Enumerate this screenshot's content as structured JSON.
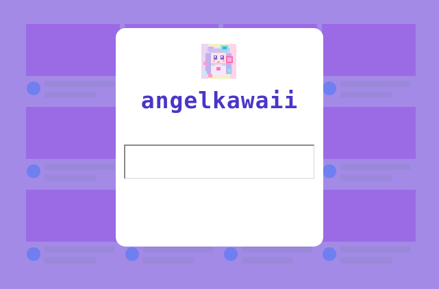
{
  "profile": {
    "username": "angelkawaii",
    "avatar_icon": "anime-girl-pixel-avatar"
  },
  "message_input": {
    "value": "",
    "placeholder": ""
  },
  "colors": {
    "page_background": "#a38ae6",
    "thumbnail": "#9b6be6",
    "avatar_placeholder": "#6f7ff0",
    "text_placeholder": "#9a88da",
    "username": "#4a36c8",
    "modal": "#ffffff"
  }
}
